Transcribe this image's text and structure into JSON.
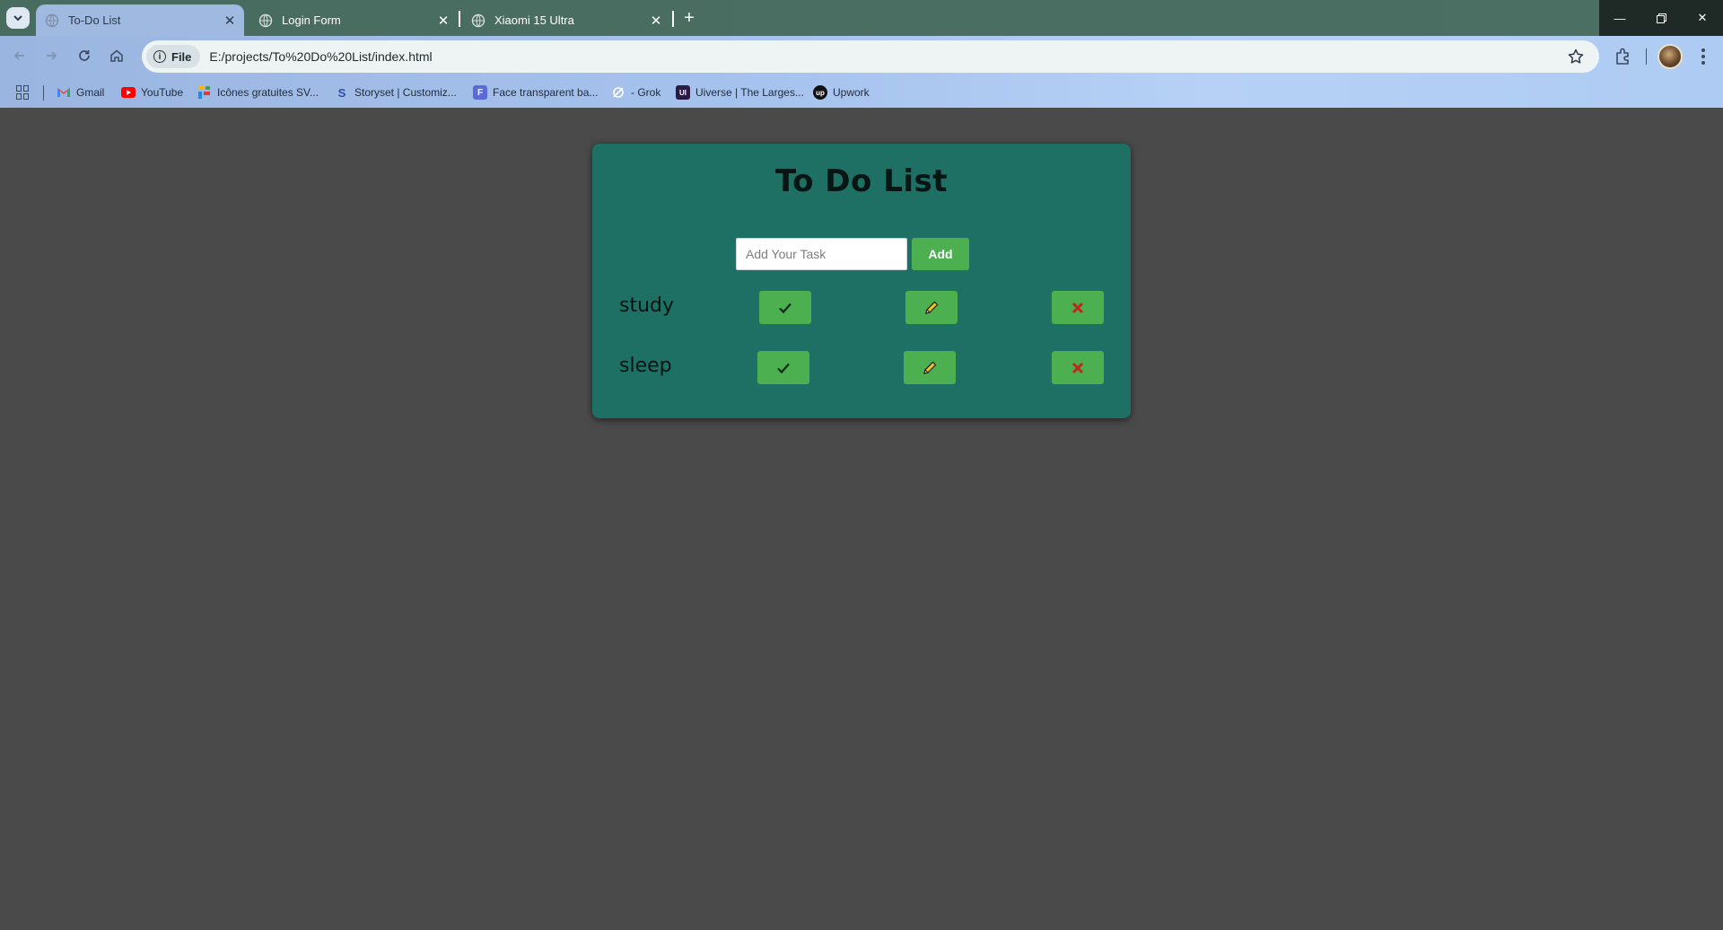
{
  "browser": {
    "tabs": [
      {
        "title": "To-Do List",
        "active": true
      },
      {
        "title": "Login Form",
        "active": false
      },
      {
        "title": "Xiaomi 15 Ultra",
        "active": false
      }
    ],
    "address": {
      "scheme_chip": "File",
      "url": "E:/projects/To%20Do%20List/index.html"
    },
    "bookmarks": [
      {
        "label": "Gmail",
        "icon": "gmail-icon"
      },
      {
        "label": "YouTube",
        "icon": "youtube-icon"
      },
      {
        "label": "Icônes gratuites SV...",
        "icon": "flaticon-icon"
      },
      {
        "label": "Storyset | Customiz...",
        "icon": "storyset-icon"
      },
      {
        "label": "Face transparent ba...",
        "icon": "face-icon"
      },
      {
        "label": "- Grok",
        "icon": "grok-icon"
      },
      {
        "label": "Uiverse | The Larges...",
        "icon": "uiverse-icon"
      },
      {
        "label": "Upwork",
        "icon": "upwork-icon"
      }
    ]
  },
  "app": {
    "title": "To Do List",
    "input": {
      "placeholder": "Add Your Task",
      "value": ""
    },
    "add_label": "Add",
    "tasks": [
      {
        "label": "study"
      },
      {
        "label": "sleep"
      }
    ]
  },
  "colors": {
    "page_bg": "#4a4a4a",
    "card_bg": "#1e6f64",
    "button_green": "#4caf50",
    "check": "#0b2a10",
    "pencil": "#f0c419",
    "delete_x": "#c0281e"
  }
}
